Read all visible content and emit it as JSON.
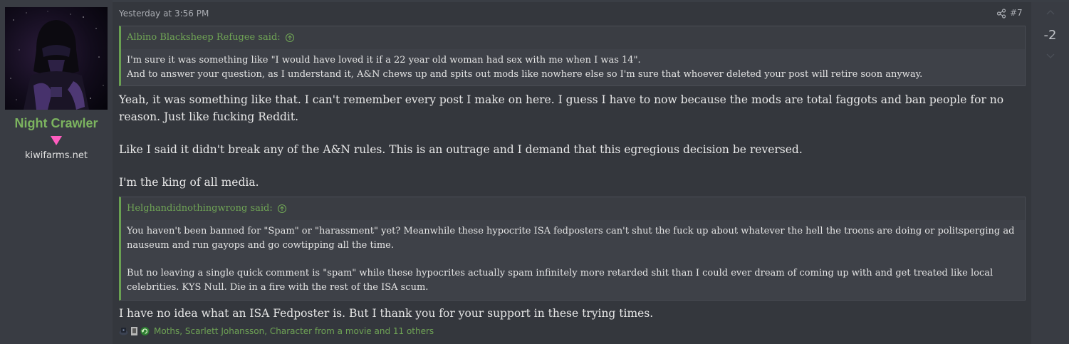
{
  "user": {
    "name": "Night Crawler",
    "site": "kiwifarms.net",
    "badge_color": "#ff5dbf",
    "name_color": "#7cb45f"
  },
  "post": {
    "time": "Yesterday at 3:56 PM",
    "number": "#7",
    "share_icon": "share-icon",
    "quotes": [
      {
        "author_line": "Albino Blacksheep Refugee said:",
        "lines": [
          "I'm sure it was something like \"I would have loved it if a 22 year old woman had sex with me when I was 14\".",
          "And to answer your question, as I understand it, A&N chews up and spits out mods like nowhere else so I'm sure that whoever deleted your post will retire soon anyway."
        ]
      },
      {
        "author_line": "Helghandidnothingwrong said:",
        "paragraph1": "You haven't been banned for \"Spam\" or \"harassment\" yet? Meanwhile these hypocrite ISA fedposters can't shut the fuck up about whatever the hell the troons are doing or politsperging ad nauseum and run gayops and go cowtipping all the time.",
        "paragraph2": "But no leaving a single quick comment is \"spam\" while these hypocrites actually spam infinitely more retarded shit than I could ever dream of coming up with and get treated like local celebrities. KYS Null. Die in a fire with the rest of the ISA scum."
      }
    ],
    "paragraphs": [
      "Yeah, it was something like that. I can't remember every post I make on here. I guess I have to now because the mods are total faggots and ban people for no reason. Just like fucking Reddit.",
      "Like I said it didn't break any of the A&N rules. This is an outrage and I demand that this egregious decision be reversed.",
      "I'm the king of all media.",
      "I have no idea what an ISA Fedposter is. But I thank you for your support in these trying times."
    ],
    "reactions_text": "Moths, Scarlett Johansson, Character from a movie and 11 others",
    "accent_color": "#6fa455"
  },
  "vote": {
    "score": "-2"
  }
}
